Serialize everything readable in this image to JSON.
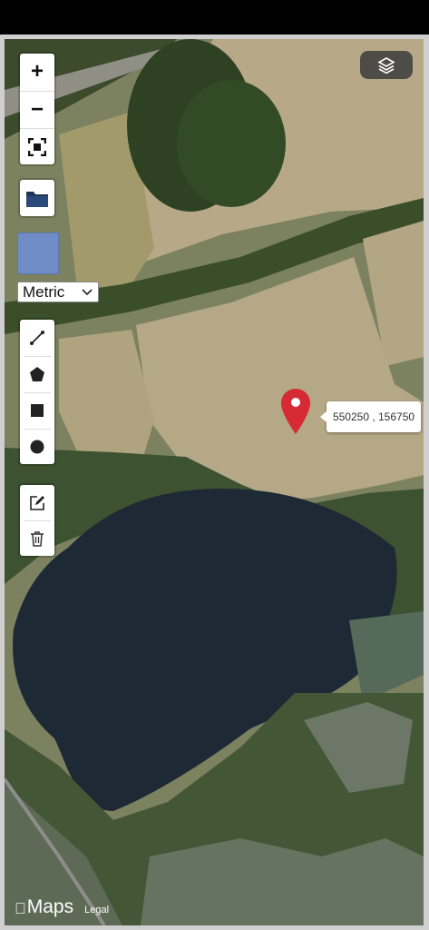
{
  "map": {
    "zoom_in_label": "+",
    "zoom_out_label": "−",
    "units": {
      "selected": "Metric"
    },
    "marker": {
      "coordinates": "550250 , 156750",
      "color": "#d62b35"
    },
    "attribution": {
      "brand": "Maps",
      "legal": "Legal"
    },
    "swatch_color": "#6f8cc6"
  },
  "icons": {
    "zoom_in": "plus-icon",
    "zoom_out": "minus-icon",
    "fullscreen": "fullscreen-icon",
    "open": "folder-icon",
    "line": "line-icon",
    "polygon": "pentagon-icon",
    "rectangle": "square-icon",
    "circle": "circle-icon",
    "edit": "edit-icon",
    "delete": "trash-icon",
    "layers": "layers-icon",
    "brand": "apple-icon"
  }
}
